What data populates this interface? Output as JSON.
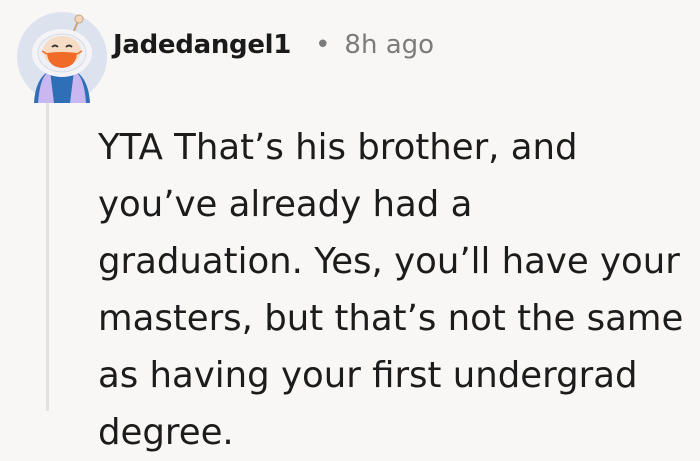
{
  "comment": {
    "author": "Jadedangel1",
    "separator": "•",
    "time_ago": "8h ago",
    "body": "YTA That’s his brother, and you’ve already had a graduation. Yes, you’ll have your masters, but that’s not the same as having your first undergrad degree.",
    "avatar_icon": "snoo-avatar-icon"
  }
}
